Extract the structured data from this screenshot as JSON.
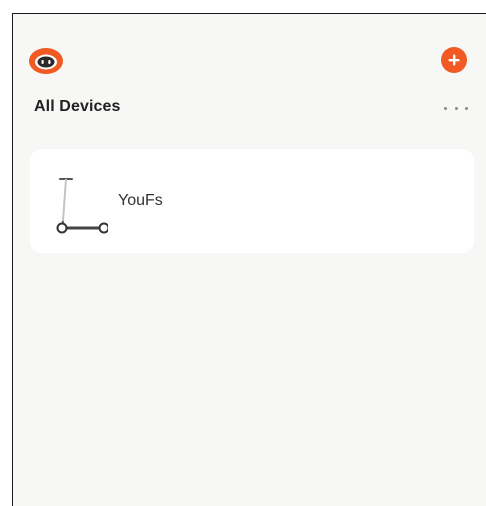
{
  "header": {
    "avatar_icon": "robot-face-icon",
    "add_icon": "plus-icon",
    "accent_color": "#f15a22"
  },
  "main": {
    "title": "All Devices",
    "more_icon": "ellipsis-icon",
    "devices": [
      {
        "name": "YouFs",
        "icon": "kick-scooter-icon"
      }
    ]
  }
}
